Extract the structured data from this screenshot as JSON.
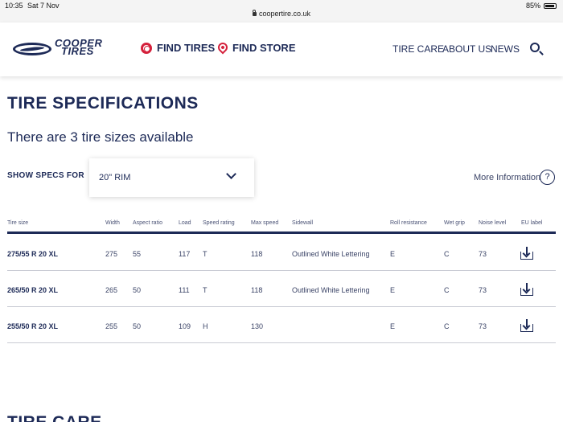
{
  "status_bar": {
    "time": "10:35",
    "date": "Sat 7 Nov",
    "battery": "85%",
    "url": "coopertire.co.uk"
  },
  "header": {
    "logo_line1": "COOPER",
    "logo_line2": "TIRES",
    "find_tires": "FIND TIRES",
    "find_store": "FIND STORE",
    "tire_care": "TIRE CARE",
    "about_us": "ABOUT US",
    "news": "NEWS"
  },
  "page": {
    "title": "TIRE SPECIFICATIONS",
    "sizes_available": "There are 3 tire sizes available",
    "show_specs_label": "SHOW SPECS FOR",
    "rim_selected": "20\" RIM",
    "more_info": "More Information",
    "help_glyph": "?",
    "next_section": "TIRE CARE"
  },
  "table": {
    "headers": [
      "Tire size",
      "Width",
      "Aspect ratio",
      "Load",
      "Speed rating",
      "Max speed",
      "Sidewall",
      "Roll resistance",
      "Wet grip",
      "Noise level",
      "EU label"
    ],
    "rows": [
      [
        "275/55 R 20 XL",
        "275",
        "55",
        "117",
        "T",
        "118",
        "Outlined White Lettering",
        "E",
        "C",
        "73"
      ],
      [
        "265/50 R 20 XL",
        "265",
        "50",
        "111",
        "T",
        "118",
        "Outlined White Lettering",
        "E",
        "C",
        "73"
      ],
      [
        "255/50 R 20 XL",
        "255",
        "50",
        "109",
        "H",
        "130",
        "",
        "E",
        "C",
        "73"
      ]
    ]
  },
  "colors": {
    "brand_navy": "#1d2a57",
    "accent_red": "#d4203b"
  }
}
